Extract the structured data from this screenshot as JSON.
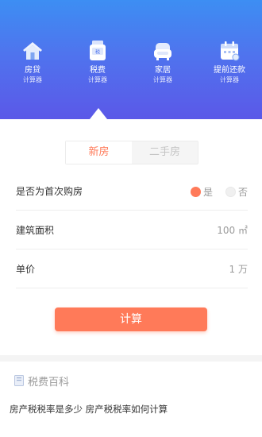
{
  "nav": {
    "items": [
      {
        "icon": "house-icon",
        "label": "房贷",
        "sub": "计算器"
      },
      {
        "icon": "tax-doc-icon",
        "label": "税费",
        "sub": "计算器"
      },
      {
        "icon": "sofa-icon",
        "label": "家居",
        "sub": "计算器"
      },
      {
        "icon": "calendar-icon",
        "label": "提前还款",
        "sub": "计算器"
      }
    ],
    "active_index": 1
  },
  "tabs": {
    "new": "新房",
    "second": "二手房",
    "active": "new"
  },
  "form": {
    "first_home": {
      "label": "是否为首次购房",
      "yes": "是",
      "no": "否",
      "selected": "yes"
    },
    "area": {
      "label": "建筑面积",
      "value": "100 ㎡"
    },
    "price": {
      "label": "单价",
      "value": "1 万"
    }
  },
  "calc_label": "计算",
  "baike": {
    "title": "税费百科",
    "article": "房产税税率是多少 房产税税率如何计算"
  },
  "colors": {
    "accent": "#ff7a59",
    "header_top": "#3d8ef3",
    "header_bottom": "#5b58e8"
  }
}
